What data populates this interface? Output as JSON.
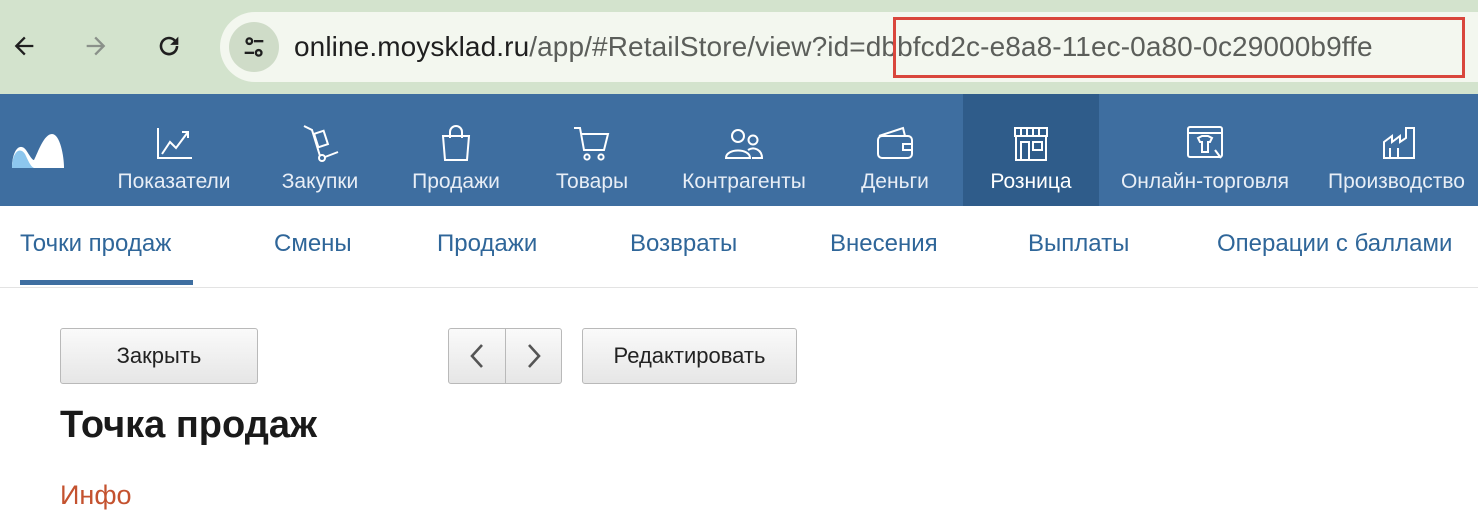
{
  "browser": {
    "url_host": "online.moysklad.ru",
    "url_path": "/app/#RetailStore/view?id=",
    "url_id": "dbbfcd2c-e8a8-11ec-0a80-0c29000b9ffe"
  },
  "topnav": {
    "items": [
      {
        "label": "Показатели",
        "icon": "chart-line-icon"
      },
      {
        "label": "Закупки",
        "icon": "hand-truck-icon"
      },
      {
        "label": "Продажи",
        "icon": "shopping-bag-icon"
      },
      {
        "label": "Товары",
        "icon": "cart-icon"
      },
      {
        "label": "Контрагенты",
        "icon": "people-icon"
      },
      {
        "label": "Деньги",
        "icon": "wallet-icon"
      },
      {
        "label": "Розница",
        "icon": "storefront-icon",
        "active": true
      },
      {
        "label": "Онлайн-торговля",
        "icon": "online-shop-icon"
      },
      {
        "label": "Производство",
        "icon": "factory-icon"
      }
    ]
  },
  "subtabs": [
    "Точки продаж",
    "Смены",
    "Продажи",
    "Возвраты",
    "Внесения",
    "Выплаты",
    "Операции с баллами"
  ],
  "toolbar": {
    "close_label": "Закрыть",
    "edit_label": "Редактировать"
  },
  "page": {
    "title": "Точка продаж",
    "section": "Инфо"
  },
  "colors": {
    "nav_bg": "#3e6ea0",
    "nav_active": "#2f5c8a",
    "link": "#2f6699",
    "section": "#c4522f",
    "highlight": "#d9463c"
  }
}
